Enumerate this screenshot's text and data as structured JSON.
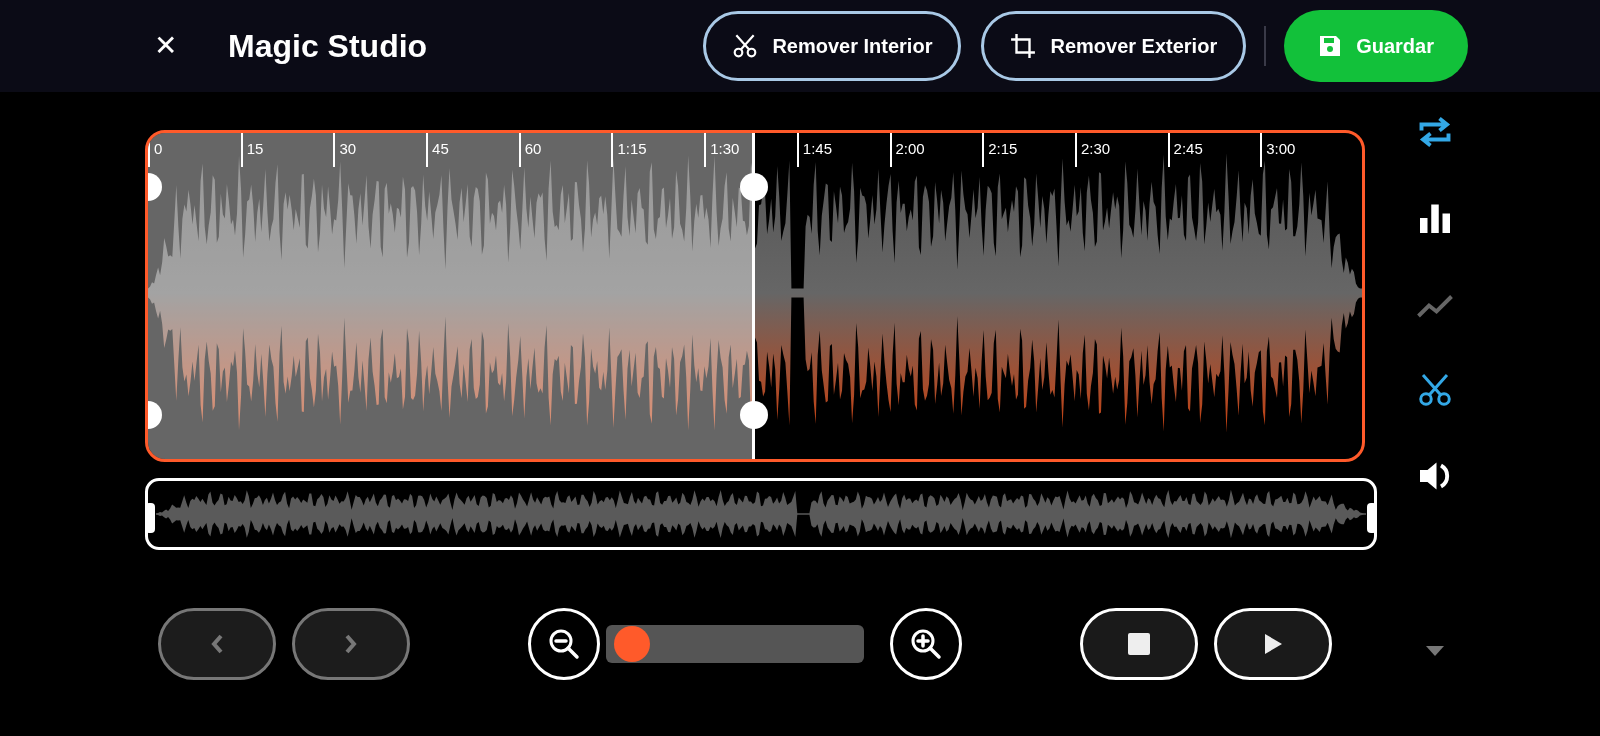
{
  "header": {
    "close_glyph": "✕",
    "title": "Magic Studio",
    "actions": [
      {
        "kind": "scissors",
        "label": "Remover Interior"
      },
      {
        "kind": "crop",
        "label": "Remover Exterior"
      }
    ],
    "save": {
      "label": "Guardar"
    }
  },
  "timeline": {
    "ticks": [
      "0",
      "15",
      "30",
      "45",
      "60",
      "1:15",
      "1:30",
      "1:45",
      "2:00",
      "2:15",
      "2:30",
      "2:45",
      "3:00"
    ]
  },
  "selected_region": {
    "level": 0.5
  },
  "tools": [
    {
      "kind": "repeat",
      "selected": true
    },
    {
      "kind": "bars",
      "selected": false
    },
    {
      "kind": "line",
      "selected": false,
      "disabled": true
    },
    {
      "kind": "scissors",
      "selected": true
    },
    {
      "kind": "speaker",
      "selected": false
    }
  ],
  "nav": [
    {
      "kind": "prev",
      "disabled": true
    },
    {
      "kind": "next",
      "disabled": true
    }
  ],
  "zoom": {
    "level": 0.03
  },
  "playback": [
    {
      "kind": "stop"
    },
    {
      "kind": "play"
    }
  ]
}
